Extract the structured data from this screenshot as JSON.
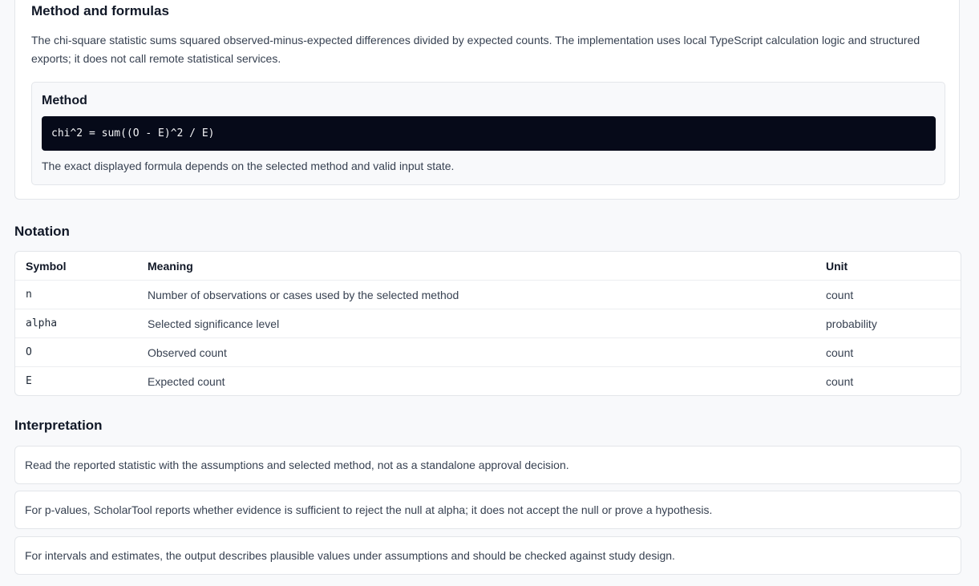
{
  "method_section": {
    "title": "Method and formulas",
    "description": "The chi-square statistic sums squared observed-minus-expected differences divided by expected counts. The implementation uses local TypeScript calculation logic and structured exports; it does not call remote statistical services.",
    "formula_heading": "Method",
    "formula": "chi^2 = sum((O - E)^2 / E)",
    "formula_note": "The exact displayed formula depends on the selected method and valid input state."
  },
  "notation": {
    "title": "Notation",
    "headers": {
      "symbol": "Symbol",
      "meaning": "Meaning",
      "unit": "Unit"
    },
    "rows": [
      {
        "symbol": "n",
        "meaning": "Number of observations or cases used by the selected method",
        "unit": "count"
      },
      {
        "symbol": "alpha",
        "meaning": "Selected significance level",
        "unit": "probability"
      },
      {
        "symbol": "O",
        "meaning": "Observed count",
        "unit": "count"
      },
      {
        "symbol": "E",
        "meaning": "Expected count",
        "unit": "count"
      }
    ]
  },
  "interpretation": {
    "title": "Interpretation",
    "items": [
      "Read the reported statistic with the assumptions and selected method, not as a standalone approval decision.",
      "For p-values, ScholarTool reports whether evidence is sufficient to reject the null at alpha; it does not accept the null or prove a hypothesis.",
      "For intervals and estimates, the output describes plausible values under assumptions and should be checked against study design."
    ]
  }
}
